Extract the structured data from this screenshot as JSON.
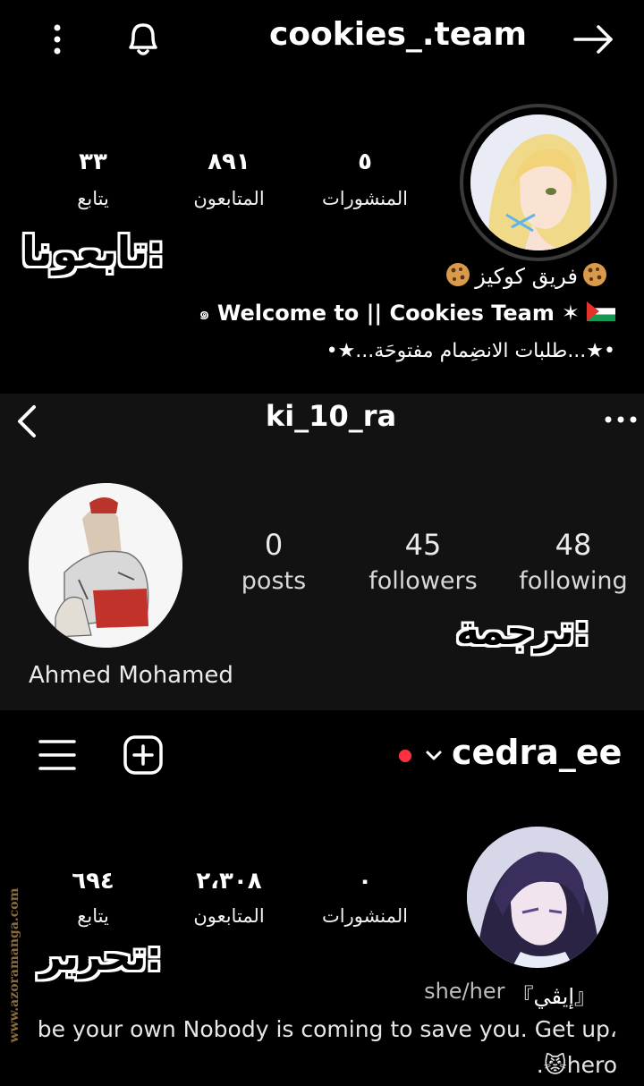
{
  "s1": {
    "username": "cookies_.team",
    "stats": [
      {
        "value": "٥",
        "label": "المنشورات"
      },
      {
        "value": "٨٩١",
        "label": "المتابعون"
      },
      {
        "value": "٣٣",
        "label": "يتابع"
      }
    ],
    "sticker": "تابعونا:",
    "display_name": "فريق كوكيز",
    "bio_line1": "Welcome to || Cookies Team",
    "bio_line1_prefix": "๑",
    "bio_line2": "•★...طلبات الانضِمام مفتوحَة...★•"
  },
  "s2": {
    "username": "ki_10_ra",
    "stats": [
      {
        "value": "0",
        "label": "posts"
      },
      {
        "value": "45",
        "label": "followers"
      },
      {
        "value": "48",
        "label": "following"
      }
    ],
    "sticker": "ترجمة:",
    "name": "Ahmed Mohamed"
  },
  "s3": {
    "username": "cedra_ee",
    "stats": [
      {
        "value": "٠",
        "label": "المنشورات"
      },
      {
        "value": "٢،٣٠٨",
        "label": "المتابعون"
      },
      {
        "value": "٦٩٤",
        "label": "يتابع"
      }
    ],
    "sticker": "تحرير:",
    "pronouns": "she/her",
    "display_name": "『إيڤي』",
    "bio_line1": "be your own Nobody is coming to save you. Get up،",
    "bio_line2": ".😾hero"
  },
  "watermark": "www.azoramanga.com",
  "colors": {
    "background": "#000000",
    "section2_background": "#121212",
    "live_dot": "#ff3040",
    "palestine_green": "#149954",
    "palestine_red": "#e4312b"
  },
  "icons": {
    "s1": [
      "more-vertical-icon",
      "bell-icon",
      "arrow-right-icon",
      "cookie-icon",
      "palestine-flag-icon"
    ],
    "s2": [
      "back-chevron-icon",
      "more-horizontal-icon"
    ],
    "s3": [
      "menu-icon",
      "new-post-icon",
      "chevron-down-icon"
    ]
  }
}
